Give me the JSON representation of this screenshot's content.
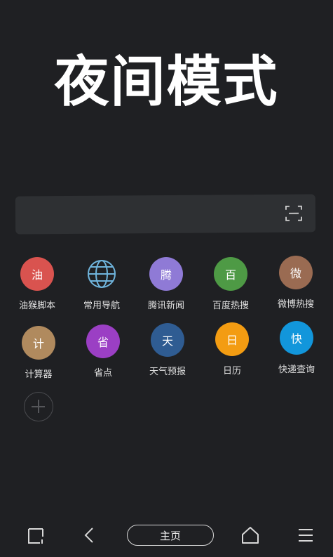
{
  "headline": "夜间模式",
  "search": {
    "value": "",
    "placeholder": "",
    "scan_icon": "scan-icon"
  },
  "apps": [
    {
      "label": "油猴脚本",
      "glyph": "油",
      "color": "#d9534f"
    },
    {
      "label": "常用导航",
      "glyph": "",
      "color": "#1f2023"
    },
    {
      "label": "腾讯新闻",
      "glyph": "腾",
      "color": "#8f7ad6"
    },
    {
      "label": "百度热搜",
      "glyph": "百",
      "color": "#4e9a45"
    },
    {
      "label": "微博热搜",
      "glyph": "微",
      "color": "#9a6b52"
    },
    {
      "label": "计算器",
      "glyph": "计",
      "color": "#b08a5e"
    },
    {
      "label": "省点",
      "glyph": "省",
      "color": "#9b3fc4"
    },
    {
      "label": "天气预报",
      "glyph": "天",
      "color": "#2f5c92"
    },
    {
      "label": "日历",
      "glyph": "日",
      "color": "#f39c12"
    },
    {
      "label": "快递查询",
      "glyph": "快",
      "color": "#1296db"
    }
  ],
  "add_button": "plus-icon",
  "bottom_nav": {
    "home_label": "主页"
  }
}
